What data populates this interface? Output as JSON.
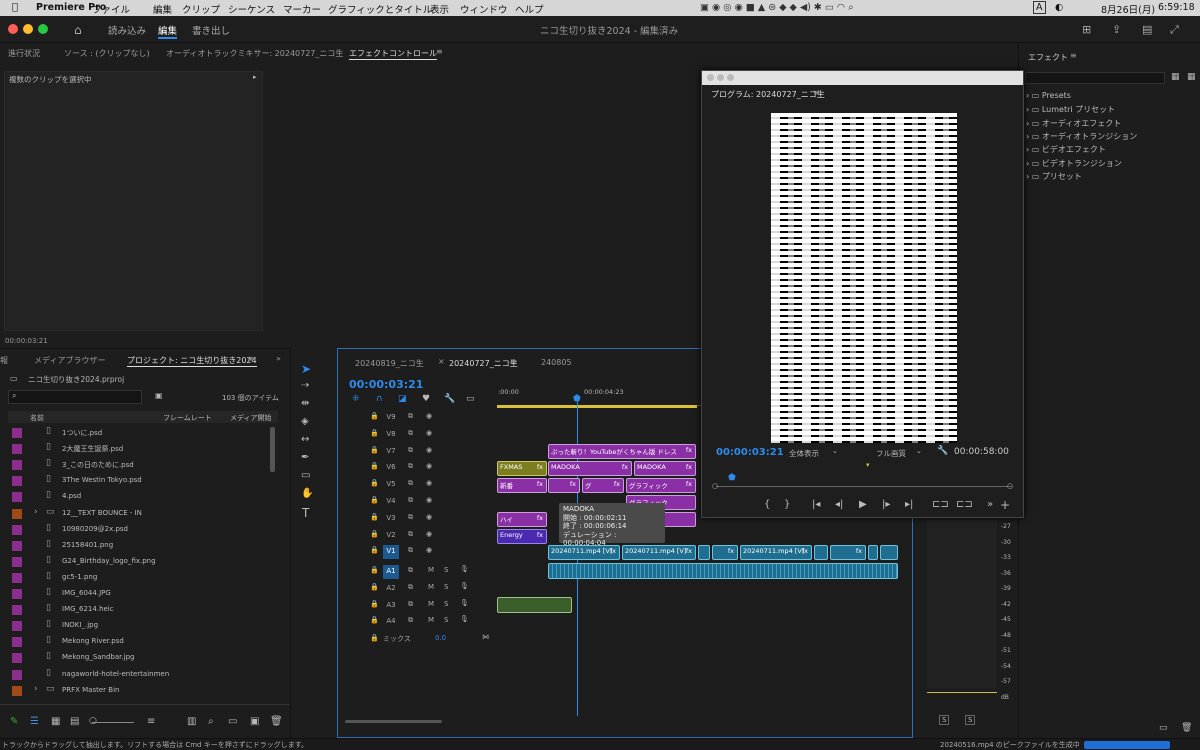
{
  "menubar": {
    "app": "Premiere Pro",
    "items": [
      "ファイル",
      "編集",
      "クリップ",
      "シーケンス",
      "マーカー",
      "グラフィックとタイトル",
      "表示",
      "ウィンドウ",
      "ヘルプ"
    ],
    "date": "8月26日(月)",
    "time": "6:59:18",
    "input": "A"
  },
  "titlebar": {
    "tabs": [
      "読み込み",
      "編集",
      "書き出し"
    ],
    "doc": "ニコ生切り抜き2024 - 編集済み"
  },
  "top_panel": {
    "tabs": [
      "進行状況",
      "ソース : (クリップなし)",
      "オーディオトラックミキサー: 20240727_ニコ生",
      "エフェクトコントロール"
    ],
    "info": "複数のクリップを選択中",
    "timecode": "00:00:03:21"
  },
  "project": {
    "tabs": [
      "報",
      "メディアブラウザー",
      "プロジェクト: ニコ生切り抜き2024"
    ],
    "file": "ニコ生切り抜き2024.prproj",
    "count": "103 個のアイテム",
    "cols": [
      "名前",
      "フレームレート",
      "メディア開始"
    ],
    "items": [
      {
        "name": "1ついに.psd",
        "color": "#8c2e8c"
      },
      {
        "name": "2大魔王生誕祭.psd",
        "color": "#8c2e8c"
      },
      {
        "name": "3_この日のために.psd",
        "color": "#8c2e8c"
      },
      {
        "name": "3The Westin Tokyo.psd",
        "color": "#8c2e8c"
      },
      {
        "name": "4.psd",
        "color": "#8c2e8c"
      },
      {
        "name": "12__TEXT BOUNCE - IN",
        "color": "#a04a1a"
      },
      {
        "name": "10980209@2x.psd",
        "color": "#8c2e8c"
      },
      {
        "name": "25158401.png",
        "color": "#8c2e8c"
      },
      {
        "name": "G24_Birthday_logo_fix.png",
        "color": "#8c2e8c"
      },
      {
        "name": "gc5-1.png",
        "color": "#8c2e8c"
      },
      {
        "name": "IMG_6044.JPG",
        "color": "#8c2e8c"
      },
      {
        "name": "IMG_6214.heic",
        "color": "#8c2e8c"
      },
      {
        "name": "INOKI_.jpg",
        "color": "#8c2e8c"
      },
      {
        "name": "Mekong River.psd",
        "color": "#8c2e8c"
      },
      {
        "name": "Mekong_Sandbar.jpg",
        "color": "#8c2e8c"
      },
      {
        "name": "nagaworld-hotel-entertainmen",
        "color": "#8c2e8c"
      },
      {
        "name": "PRFX Master Bin",
        "color": "#a04a1a"
      }
    ]
  },
  "timeline": {
    "tabs": [
      "20240819_ニコ生",
      "20240727_ニコ生",
      "240805"
    ],
    "timecode": "00:00:03:21",
    "ruler": [
      ":00:00",
      "00:00:04:23"
    ],
    "vtracks": [
      "V9",
      "V8",
      "V7",
      "V6",
      "V5",
      "V4",
      "V3",
      "V2",
      "V1"
    ],
    "atracks": [
      "A1",
      "A2",
      "A3",
      "A4"
    ],
    "mix": "ミックス",
    "mixval": "0.0",
    "clips": {
      "c1": "ぷった斬り！YouTubeがくちゃん版 ドレス",
      "c2": "FXMAS",
      "c3": "MADOKA",
      "c4": "MADOKA",
      "c5": "新番",
      "c6": "グ",
      "c7": "グラフィック",
      "c8": "グラフィック",
      "c9": "ハイ",
      "c10": "Energy",
      "v1a": "20240711.mp4 [V]",
      "v1b": "20240711.mp4 [V]",
      "v1c": "20240711.mp4 [V]",
      "fx": "fx"
    }
  },
  "tooltip": {
    "name": "MADOKA",
    "start": "開始 : 00:00:02:11",
    "end": "終了 : 00:00:06:14",
    "dur": "デュレーション : 00:00:04:04"
  },
  "program": {
    "title": "プログラム: 20240727_ニコ生",
    "tc": "00:00:03:21",
    "fit": "全体表示",
    "quality": "フル画質",
    "dur": "00:00:58:00"
  },
  "effects": {
    "title": "エフェクト",
    "items": [
      "Presets",
      "Lumetri プリセット",
      "オーディオエフェクト",
      "オーディオトランジション",
      "ビデオエフェクト",
      "ビデオトランジション",
      "プリセット"
    ]
  },
  "meter": {
    "labels": [
      "-27",
      "-30",
      "-33",
      "-36",
      "-39",
      "-42",
      "-45",
      "-48",
      "-51",
      "-54",
      "-57",
      "dB"
    ],
    "solo": "S"
  },
  "status": {
    "left": "トラックからドラッグして抽出します。リフトする場合は Cmd キーを押さずにドラッグします。",
    "right": "20240516.mp4 のピークファイルを生成中"
  },
  "colors": {
    "accent": "#2d8ceb",
    "purple": "#8b2fa6",
    "teal": "#1f6e8f",
    "olive": "#7c7d1f"
  }
}
